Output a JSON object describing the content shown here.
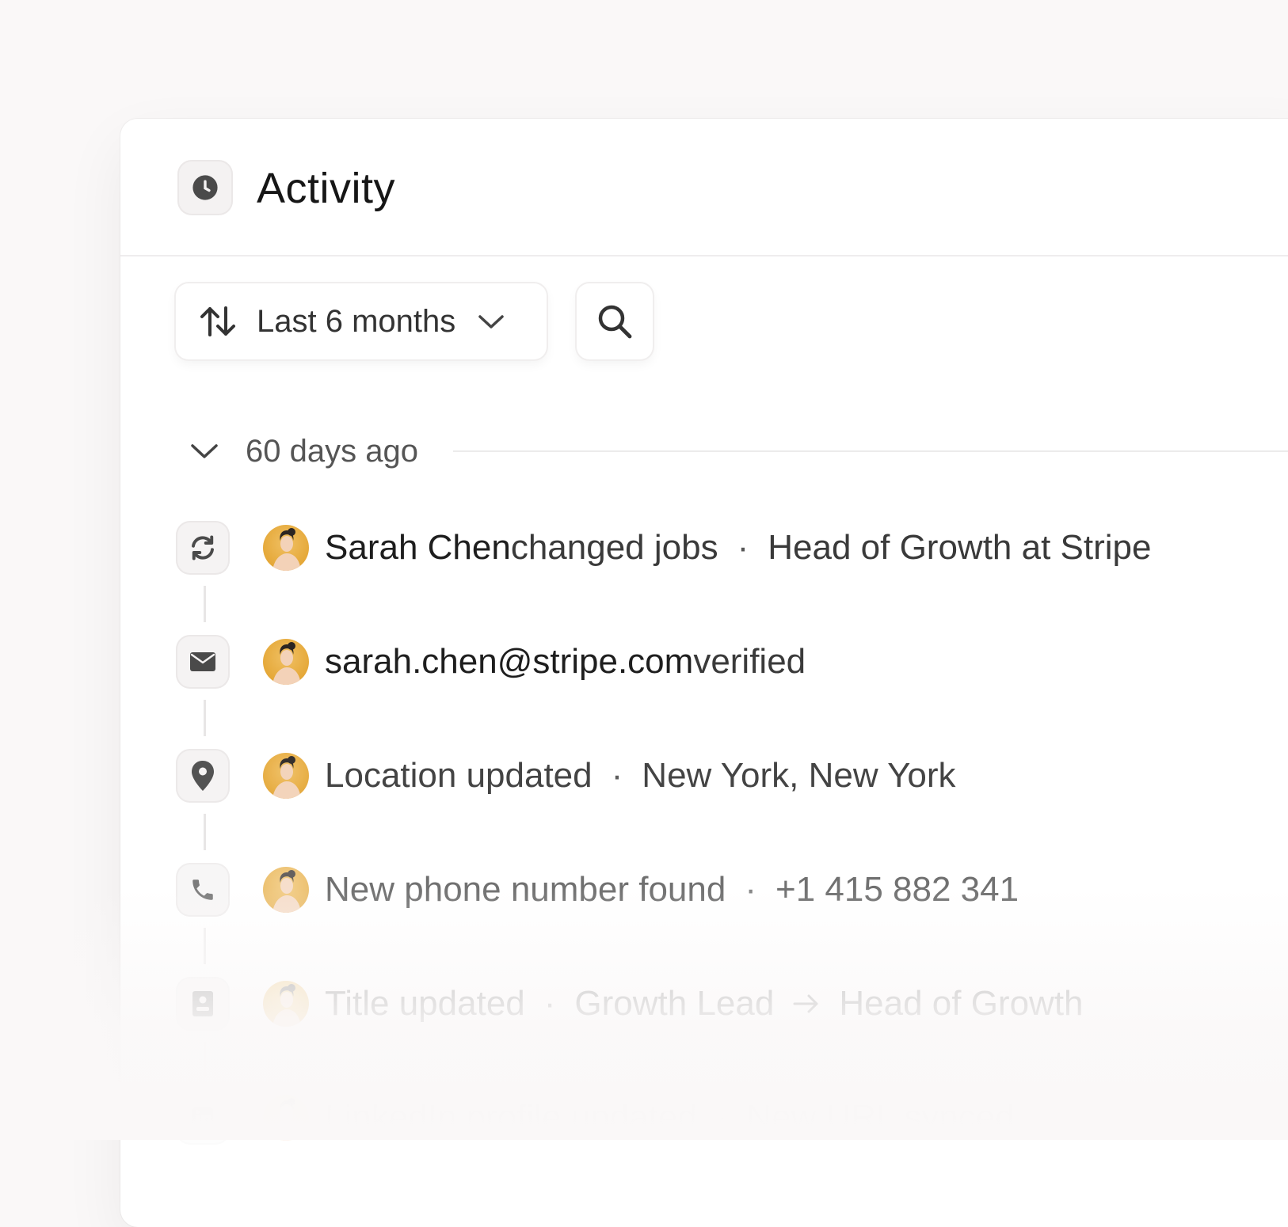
{
  "panel": {
    "title": "Activity",
    "title_icon": "clock-icon"
  },
  "toolbar": {
    "sort_icon": "sort-arrows-icon",
    "filter_label": "Last 6 months",
    "filter_chevron_icon": "chevron-down-icon",
    "search_icon": "search-icon"
  },
  "group": {
    "label": "60 days ago",
    "chevron_icon": "chevron-down-icon"
  },
  "events": [
    {
      "icon": "refresh-icon",
      "strong": "Sarah Chen",
      "text": " changed jobs",
      "sep": "·",
      "detail": "Head of Growth at Stripe",
      "opacity": 1.0
    },
    {
      "icon": "mail-icon",
      "strong": "sarah.chen@stripe.com",
      "text": " verified",
      "opacity": 1.0
    },
    {
      "icon": "location-pin-icon",
      "strong": "",
      "text": "Location updated",
      "sep": "·",
      "detail": "New York, New York",
      "opacity": 0.95
    },
    {
      "icon": "phone-icon",
      "strong": "",
      "text": "New phone number found",
      "sep": "·",
      "detail": "+1 415 882 341",
      "opacity": 0.75
    },
    {
      "icon": "id-card-icon",
      "strong": "",
      "text": "Title updated",
      "sep": "·",
      "detail": "Growth Lead",
      "arrow_icon": "arrow-right-icon",
      "detail2": "Head of Growth",
      "opacity": 0.45
    },
    {
      "icon": "linkedin-icon",
      "strong": "",
      "text": "LinkedIn profile updated",
      "sep": "·",
      "detail": "New URL synced",
      "opacity": 0.18
    }
  ],
  "colors": {
    "background": "#faf8f8",
    "panel": "#ffffff",
    "avatar": "#e5a838",
    "icon": "#4a4a4a"
  }
}
